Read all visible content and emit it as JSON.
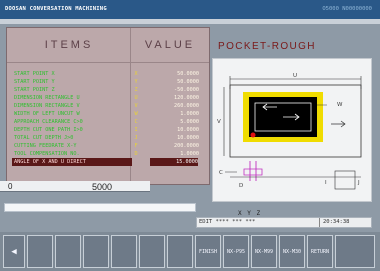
{
  "header": {
    "title": "DOOSAN CONVERSATION MACHINING",
    "code": "O5000 N00000000"
  },
  "columns": {
    "items": "ITEMS",
    "value": "VALUE"
  },
  "rows": [
    {
      "label": "START POINT X",
      "axis": "X",
      "value": "50.0000"
    },
    {
      "label": "START POINT Y",
      "axis": "Y",
      "value": "50.0000"
    },
    {
      "label": "START POINT Z",
      "axis": "Z",
      "value": "-50.0000"
    },
    {
      "label": "DIMENSION RECTANGLE U",
      "axis": "U",
      "value": "120.0000"
    },
    {
      "label": "DIMENSION RECTANGLE V",
      "axis": "V",
      "value": "260.0000"
    },
    {
      "label": "WIDTH OF LEFT UNCUT W",
      "axis": "W",
      "value": "1.0000"
    },
    {
      "label": "APPROACH CLEARANCE C>0",
      "axis": "C",
      "value": "5.0000"
    },
    {
      "label": "DEPTH CUT ONE PATH I>0",
      "axis": "I",
      "value": "10.0000"
    },
    {
      "label": "TOTAL CUT DEPTH    J>0",
      "axis": "J",
      "value": "10.0000"
    },
    {
      "label": "CUTTING FEEDRATE X-Y",
      "axis": "F",
      "value": "200.0000"
    },
    {
      "label": "TOOL COMPENSATION NO.",
      "axis": "D",
      "value": "1.0000"
    },
    {
      "label": "ANGLE OF X AND U DIRECT",
      "axis": "",
      "value": "15.0000",
      "selected": true
    }
  ],
  "counter": {
    "left": "0",
    "value": "5000"
  },
  "diagram": {
    "title": "POCKET-ROUGH",
    "labels": {
      "U": "U",
      "V": "V",
      "W": "W",
      "C": "C",
      "D": "D",
      "J": "J",
      "I": "I"
    }
  },
  "axes_label": "X Y Z",
  "status": {
    "edit": "EDIT **** *** ***",
    "time": "20:34:38"
  },
  "softkeys": [
    {
      "label": "◀"
    },
    {
      "label": ""
    },
    {
      "label": ""
    },
    {
      "label": ""
    },
    {
      "label": ""
    },
    {
      "label": ""
    },
    {
      "label": ""
    },
    {
      "label": "FINISH"
    },
    {
      "label": "NX-P95"
    },
    {
      "label": "NX-M99"
    },
    {
      "label": "NX-M30"
    },
    {
      "label": "RETURN"
    },
    {
      "label": ""
    }
  ],
  "colors": {
    "accent_yellow": "#f0dc00",
    "background": "#8e9aa6",
    "item_green": "#2fbf2f",
    "title_red": "#7a1a1a"
  }
}
